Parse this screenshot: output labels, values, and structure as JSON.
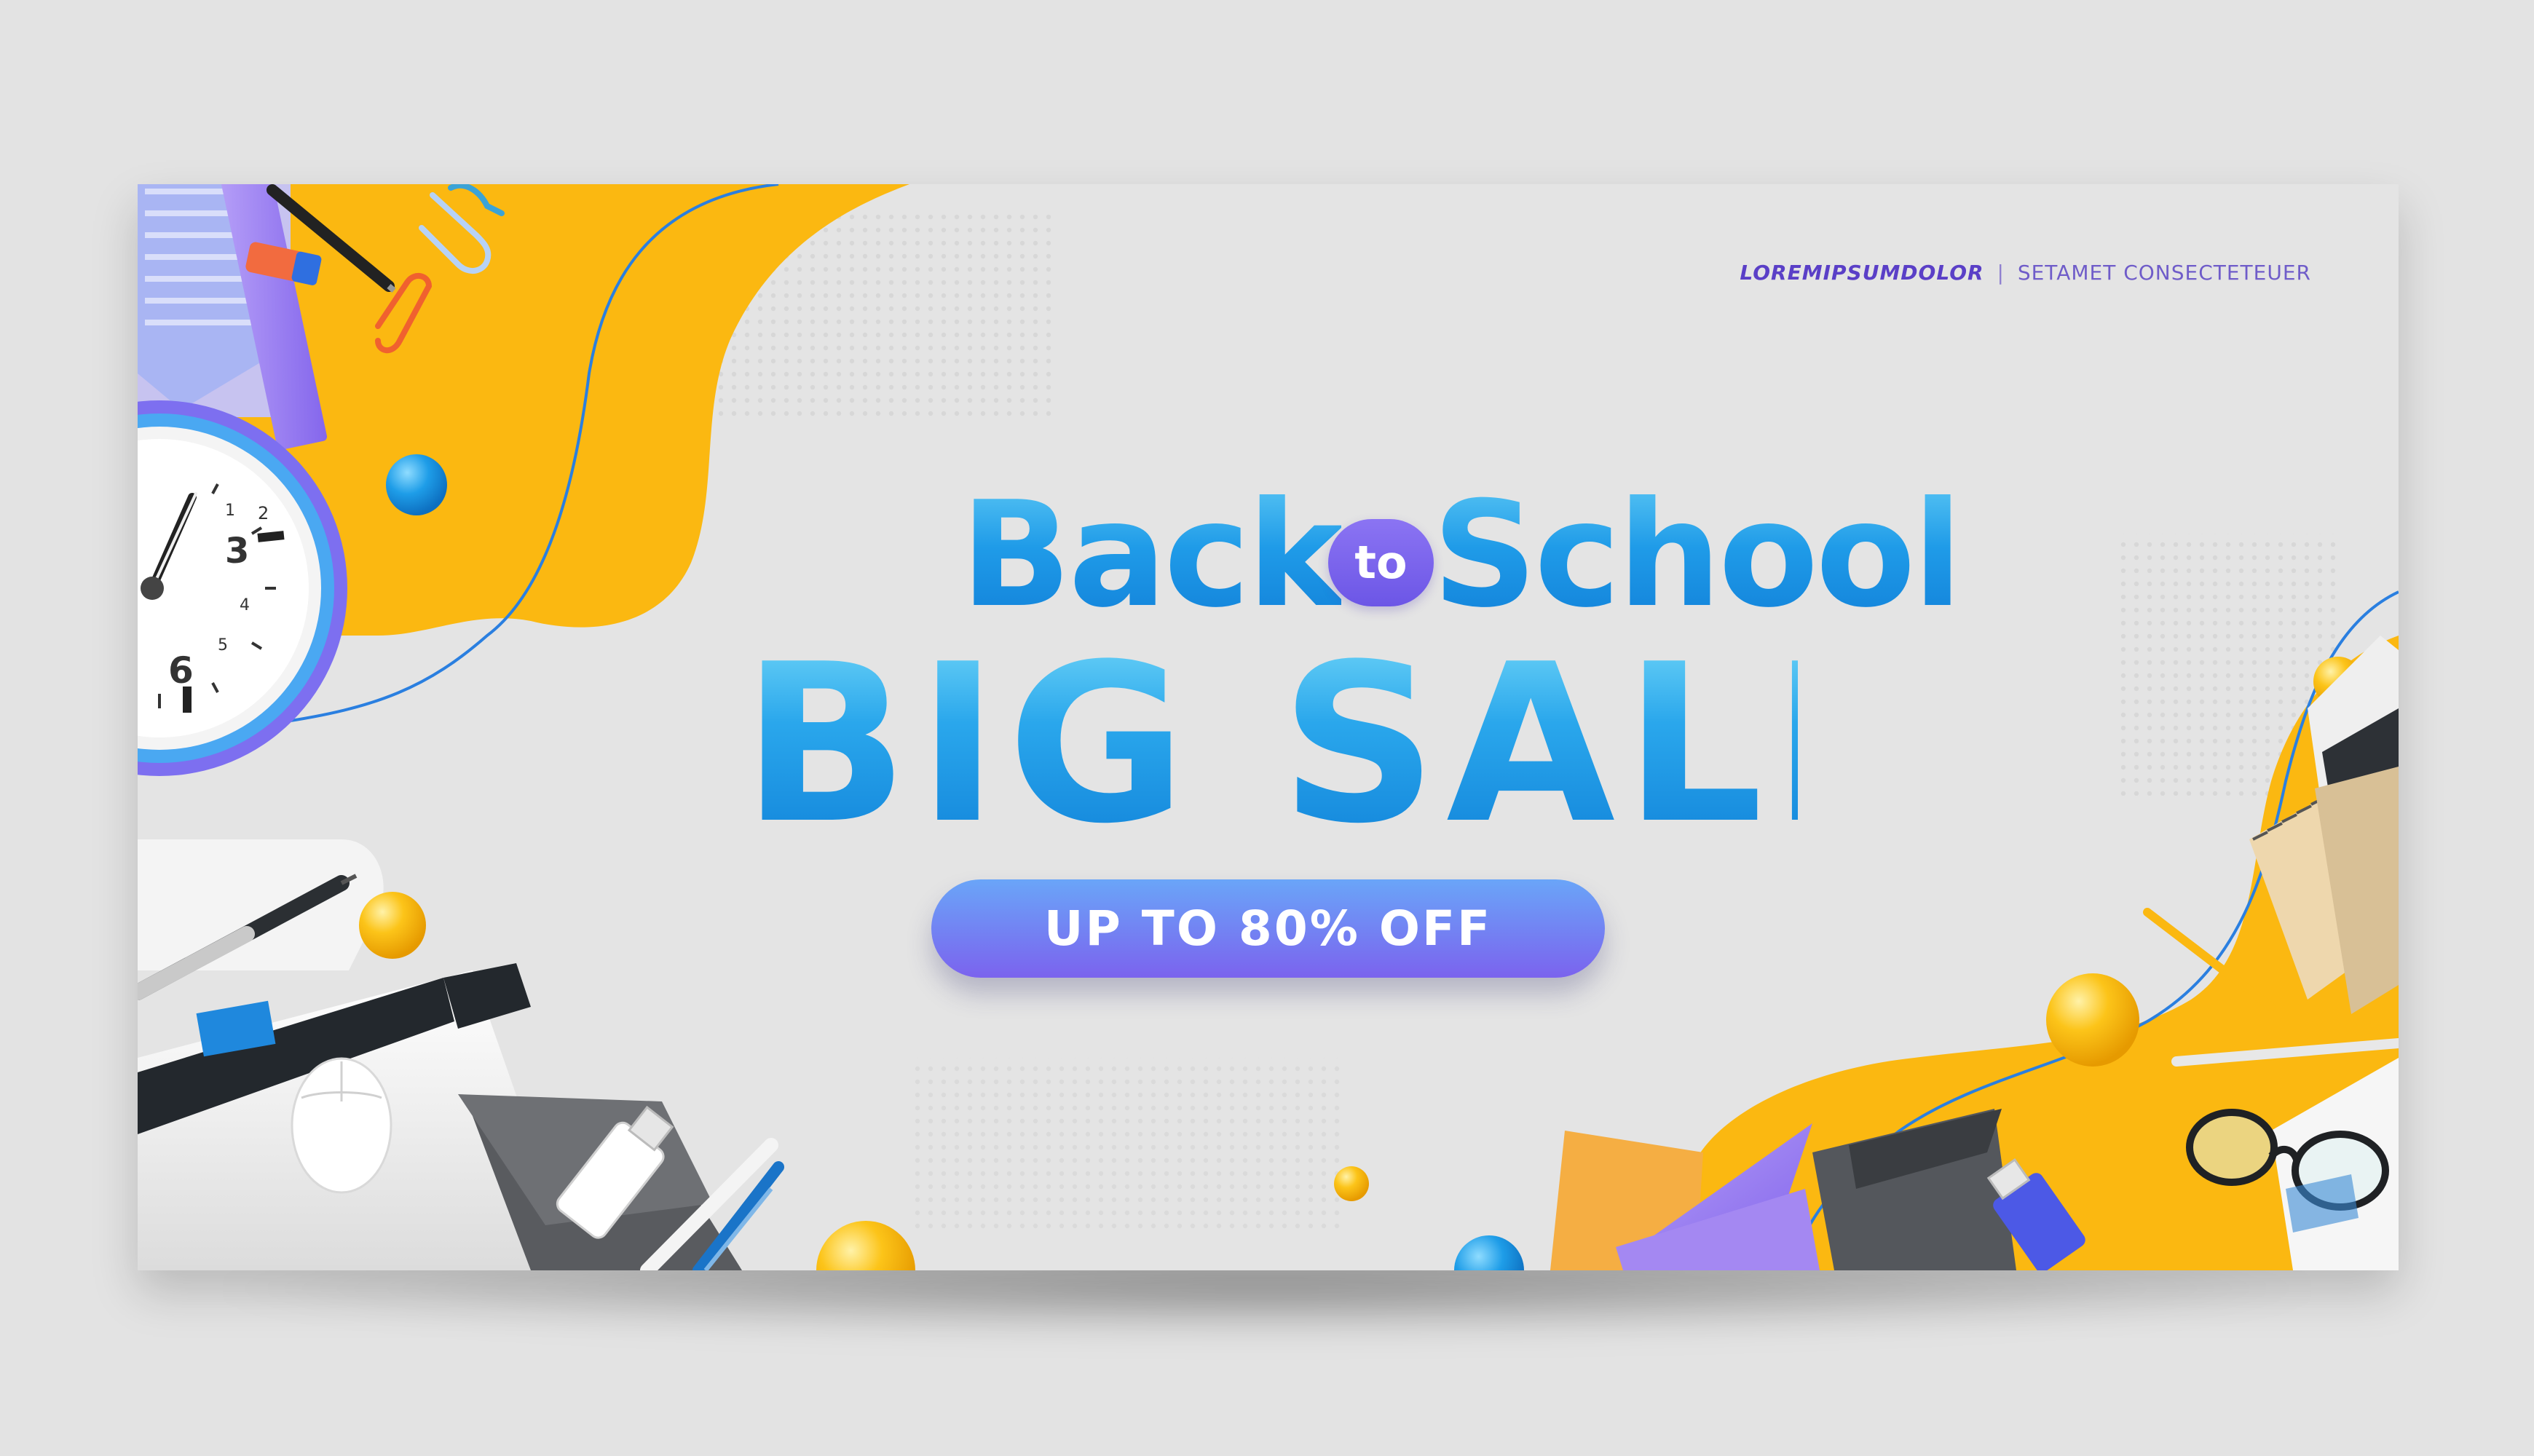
{
  "brand": {
    "bold_text": "LOREMIPSUMDOLOR",
    "separator": "|",
    "light_text": "SETAMET CONSECTETEUER"
  },
  "headline": {
    "word_back": "Back",
    "word_to": "to",
    "word_school": "School",
    "line2": "BIG SALE"
  },
  "offer": {
    "label": "UP TO 80% OFF"
  },
  "clock": {
    "numbers": [
      "1",
      "2",
      "3",
      "4",
      "5",
      "6"
    ]
  },
  "icons": [
    "clock-icon",
    "paperclip-icon",
    "pen-icon",
    "eraser-icon",
    "ruler-icon",
    "notebook-icon",
    "computer-mouse-icon",
    "usb-drive-icon",
    "pencil-icon",
    "glasses-icon",
    "sticky-note-icon",
    "tablet-icon"
  ],
  "colors": {
    "background": "#e4e4e4",
    "accent_yellow": "#fbb811",
    "headline_blue": "#1f9be8",
    "accent_purple": "#7b63ee",
    "brand_purple": "#5a3fc7"
  }
}
